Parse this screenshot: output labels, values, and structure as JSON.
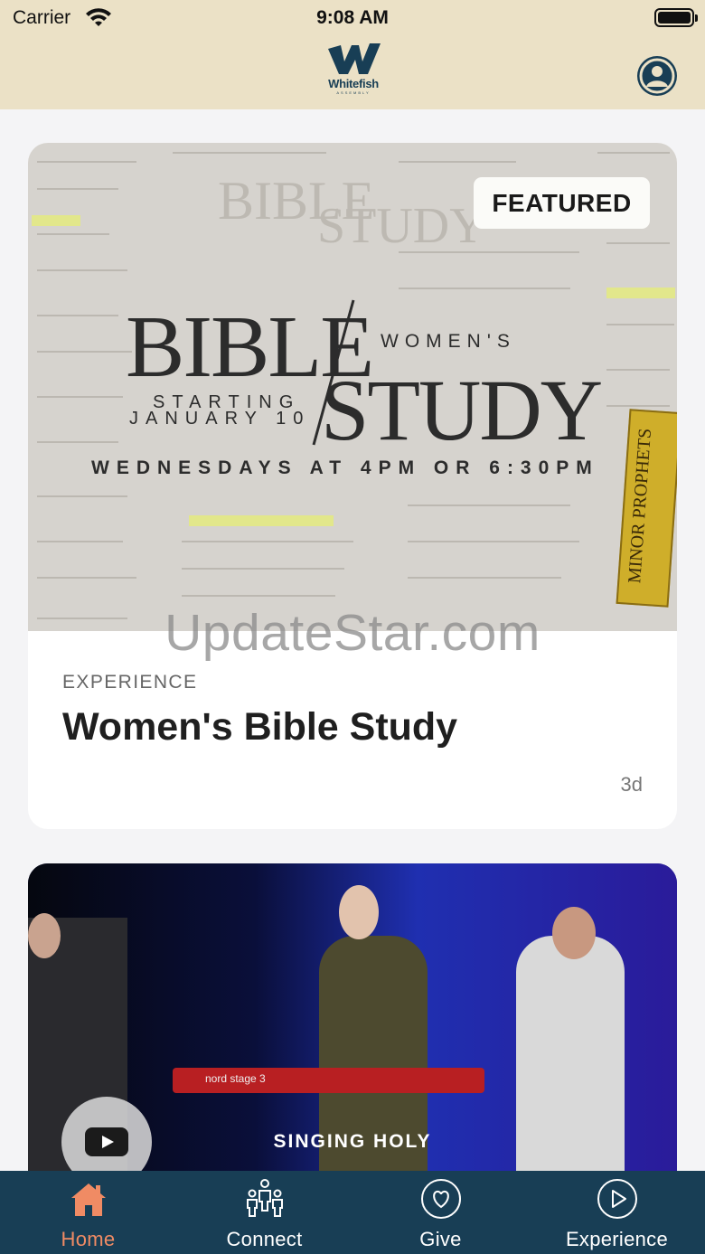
{
  "status_bar": {
    "carrier": "Carrier",
    "time": "9:08 AM"
  },
  "header": {
    "logo_text": "Whitefish",
    "logo_subtext": "ASSEMBLY"
  },
  "featured_card": {
    "badge": "FEATURED",
    "hero": {
      "word_bible": "BIBLE",
      "word_study": "STUDY",
      "womens": "WOMEN'S",
      "starting": "STARTING",
      "date": "JANUARY 10",
      "schedule": "WEDNESDAYS AT 4PM OR 6:30PM",
      "book_title": "MINOR PROPHETS"
    },
    "category": "EXPERIENCE",
    "title": "Women's Bible Study",
    "age": "3d"
  },
  "video_card": {
    "caption": "SINGING HOLY",
    "keyboard_label": "nord stage 3"
  },
  "watermark": "UpdateStar.com",
  "tabs": [
    {
      "label": "Home",
      "icon": "home-icon",
      "active": true
    },
    {
      "label": "Connect",
      "icon": "people-icon",
      "active": false
    },
    {
      "label": "Give",
      "icon": "heart-icon",
      "active": false
    },
    {
      "label": "Experience",
      "icon": "play-circle-icon",
      "active": false
    }
  ],
  "colors": {
    "header_bg": "#ebe1c6",
    "brand_navy": "#183e55",
    "active_tab": "#f08b64"
  }
}
